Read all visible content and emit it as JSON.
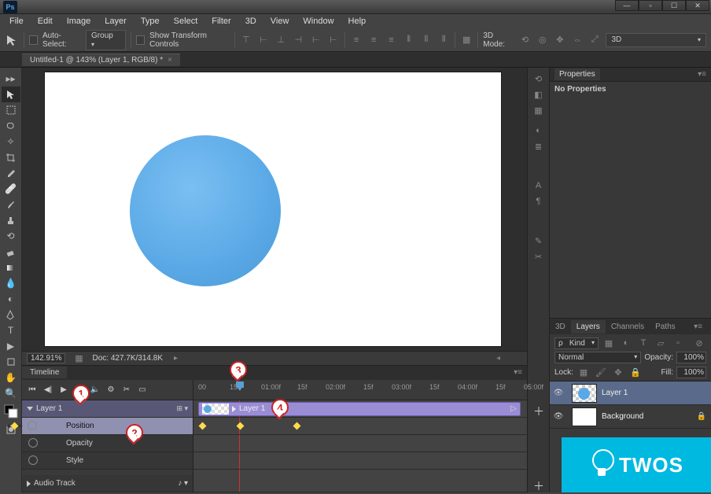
{
  "app": {
    "logo": "Ps"
  },
  "menu": [
    "File",
    "Edit",
    "Image",
    "Layer",
    "Type",
    "Select",
    "Filter",
    "3D",
    "View",
    "Window",
    "Help"
  ],
  "options": {
    "auto_select": "Auto-Select:",
    "group_dropdown": "Group",
    "show_transform": "Show Transform Controls",
    "mode_3d_label": "3D Mode:",
    "right_dropdown": "3D"
  },
  "document": {
    "tab_title": "Untitled-1 @ 143% (Layer 1, RGB/8) *"
  },
  "status": {
    "zoom": "142.91%",
    "doc_info": "Doc: 427.7K/314.8K"
  },
  "timeline": {
    "panel_title": "Timeline",
    "ruler": [
      "00",
      "15f",
      "01:00f",
      "15f",
      "02:00f",
      "15f",
      "03:00f",
      "15f",
      "04:00f",
      "15f",
      "05:00f"
    ],
    "layer_name": "Layer 1",
    "clip_name": "Layer 1",
    "props": [
      "Position",
      "Opacity",
      "Style"
    ],
    "audio": "Audio Track"
  },
  "properties": {
    "panel_title": "Properties",
    "no_props": "No Properties"
  },
  "layers_panel": {
    "tabs": [
      "3D",
      "Layers",
      "Channels",
      "Paths"
    ],
    "kind_label": "Kind",
    "blend_mode": "Normal",
    "opacity_label": "Opacity:",
    "opacity_value": "100%",
    "lock_label": "Lock:",
    "fill_label": "Fill:",
    "fill_value": "100%",
    "layers": [
      {
        "name": "Layer 1",
        "selected": true,
        "thumb": "circle"
      },
      {
        "name": "Background",
        "selected": false,
        "thumb": "bg",
        "locked": true
      }
    ]
  },
  "callouts": [
    "1",
    "2",
    "3",
    "4"
  ],
  "watermark": "TWOS"
}
